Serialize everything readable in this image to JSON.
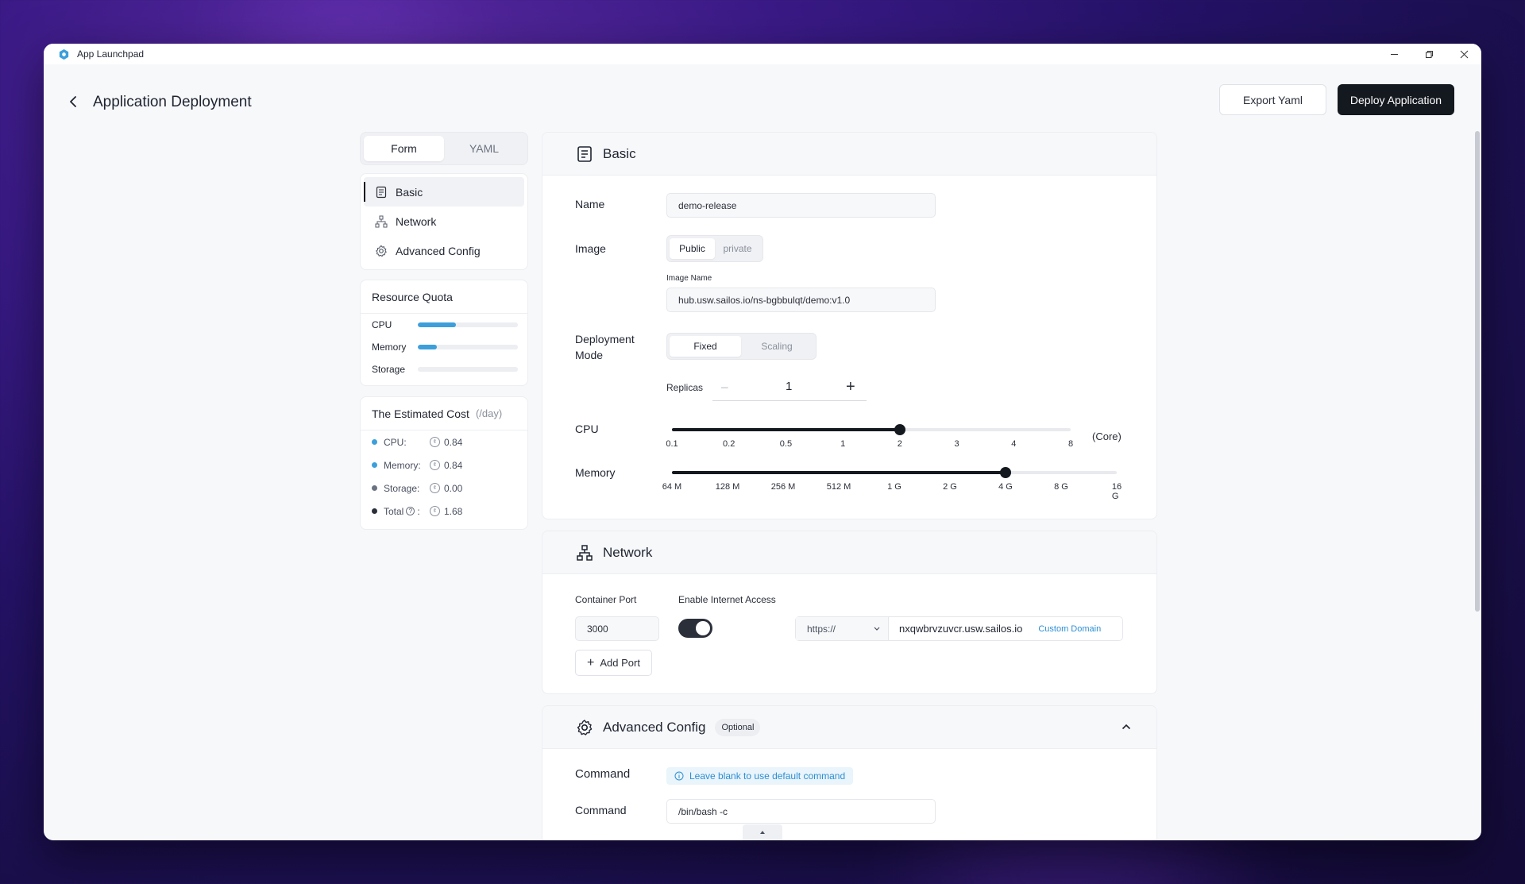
{
  "window": {
    "title": "App Launchpad"
  },
  "header": {
    "title": "Application Deployment",
    "export_label": "Export Yaml",
    "deploy_label": "Deploy Application"
  },
  "mode_tabs": [
    {
      "label": "Form",
      "active": true
    },
    {
      "label": "YAML",
      "active": false
    }
  ],
  "nav": [
    {
      "label": "Basic",
      "icon": "document-icon",
      "active": true
    },
    {
      "label": "Network",
      "icon": "network-icon",
      "active": false
    },
    {
      "label": "Advanced Config",
      "icon": "gear-icon",
      "active": false
    }
  ],
  "quota": {
    "title": "Resource Quota",
    "items": [
      {
        "label": "CPU",
        "fraction": 0.38
      },
      {
        "label": "Memory",
        "fraction": 0.19
      },
      {
        "label": "Storage",
        "fraction": 0.0
      }
    ],
    "fill_color": "#3c9fdb"
  },
  "cost": {
    "title": "The Estimated Cost",
    "unit": "(/day)",
    "items": [
      {
        "label": "CPU:",
        "value": "0.84",
        "color": "#3c9fdb"
      },
      {
        "label": "Memory:",
        "value": "0.84",
        "color": "#3c9fdb"
      },
      {
        "label": "Storage:",
        "value": "0.00",
        "color": "#6b7280"
      },
      {
        "label": "Total",
        "value": "1.68",
        "color": "#2b2f3a"
      }
    ]
  },
  "basic": {
    "title": "Basic",
    "name_label": "Name",
    "name_value": "demo-release",
    "image_label": "Image",
    "image_options": [
      {
        "label": "Public",
        "active": true
      },
      {
        "label": "private",
        "active": false
      }
    ],
    "image_name_label": "Image Name",
    "image_name_value": "hub.usw.sailos.io/ns-bgbbulqt/demo:v1.0",
    "deploy_mode_label_1": "Deployment",
    "deploy_mode_label_2": "Mode",
    "deploy_mode_options": [
      {
        "label": "Fixed",
        "active": true
      },
      {
        "label": "Scaling",
        "active": false
      }
    ],
    "replicas_label": "Replicas",
    "replicas_value": "1",
    "cpu_label": "CPU",
    "cpu_ticks": [
      "0.1",
      "0.2",
      "0.5",
      "1",
      "2",
      "3",
      "4",
      "8"
    ],
    "cpu_selected_index": 4,
    "cpu_unit": "(Core)",
    "memory_label": "Memory",
    "memory_ticks": [
      "64 M",
      "128 M",
      "256 M",
      "512 M",
      "1 G",
      "2 G",
      "4 G",
      "8 G",
      "16 G"
    ],
    "memory_selected_index": 6
  },
  "network": {
    "title": "Network",
    "port_label": "Container Port",
    "port_value": "3000",
    "internet_label": "Enable Internet Access",
    "internet_enabled": true,
    "protocol": "https://",
    "domain": "nxqwbrvzuvcr.usw.sailos.io",
    "custom_domain_label": "Custom Domain",
    "add_port_label": "Add Port"
  },
  "advanced": {
    "title": "Advanced Config",
    "badge": "Optional",
    "command_heading": "Command",
    "command_tip": "Leave blank to use default command",
    "command_label": "Command",
    "command_value": "/bin/bash -c"
  },
  "colors": {
    "accent": "#3c9fdb",
    "primary_dark": "#14181f"
  }
}
